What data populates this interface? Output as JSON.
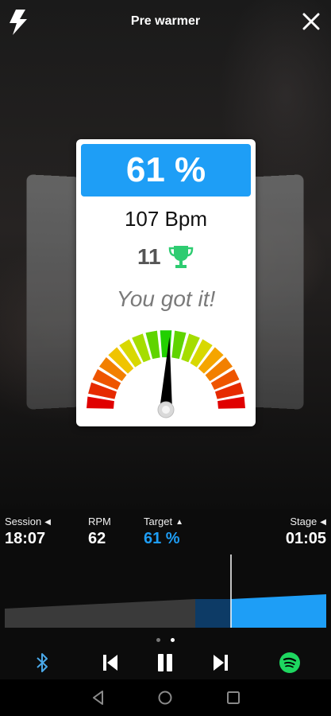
{
  "header": {
    "title": "Pre warmer",
    "left_icon": "lightning-bolt-icon",
    "right_icon": "close-icon"
  },
  "card": {
    "percent": "61 %",
    "bpm": "107 Bpm",
    "trophy_count": "11",
    "message": "You got it!",
    "gauge_level_percent": 61,
    "colors": {
      "percent_box": "#1e9ef6",
      "trophy": "#2ecc71",
      "gauge_red": "#e00000",
      "gauge_green": "#22d000"
    }
  },
  "stats": [
    {
      "label": "Session",
      "value": "18:07",
      "arrow": "◀"
    },
    {
      "label": "RPM",
      "value": "62",
      "arrow": ""
    },
    {
      "label": "Target",
      "value": "61 %",
      "arrow": "▲"
    },
    {
      "label": "Stage",
      "value": "01:05",
      "arrow": "◀"
    }
  ],
  "pager": {
    "pages": 2,
    "active": 2
  },
  "controls": [
    "bluetooth-icon",
    "skip-previous-icon",
    "pause-icon",
    "skip-next-icon",
    "spotify-icon"
  ],
  "system_nav": [
    "back-icon",
    "home-icon",
    "recents-icon"
  ]
}
